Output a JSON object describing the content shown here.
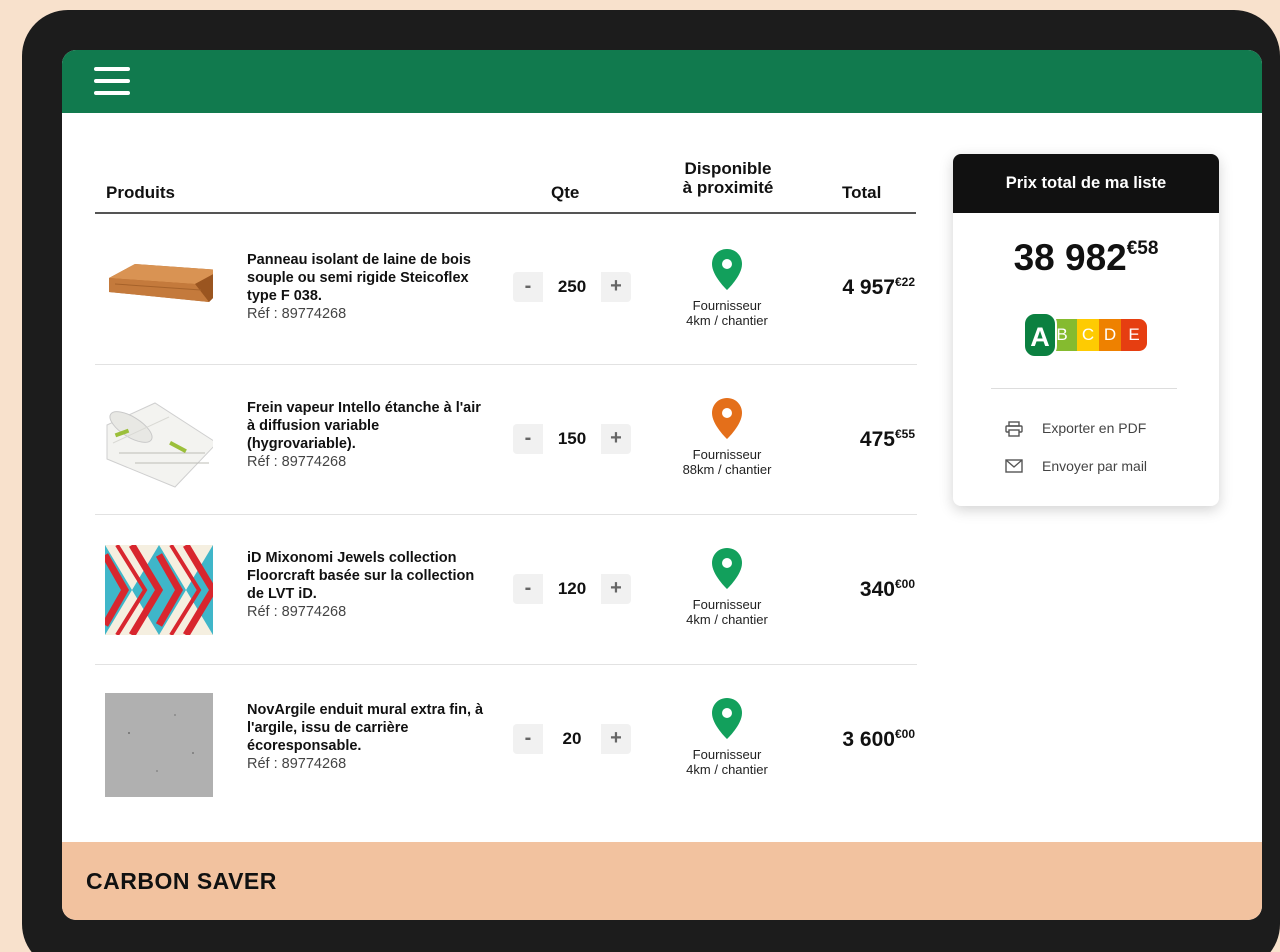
{
  "header": {
    "menu_icon": "hamburger-icon",
    "color": "#117a4e"
  },
  "columns": {
    "produits": "Produits",
    "qte": "Qte",
    "disponible_line1": "Disponible",
    "disponible_line2": "à proximité",
    "total": "Total"
  },
  "products": [
    {
      "name": "Panneau isolant de laine de bois souple ou semi rigide Steicoflex type F 038.",
      "ref": "Réf : 89774268",
      "qty": "250",
      "minus": "-",
      "plus": "+",
      "availability_icon": "map-pin-icon",
      "availability_color": "#12a05c",
      "supplier": "Fournisseur",
      "distance": "4km / chantier",
      "total_main": "4 957",
      "total_cents": "€22"
    },
    {
      "name": "Frein vapeur Intello étanche à l'air à diffusion variable (hygrovariable).",
      "ref": "Réf : 89774268",
      "qty": "150",
      "minus": "-",
      "plus": "+",
      "availability_icon": "map-pin-icon",
      "availability_color": "#e46f1a",
      "supplier": "Fournisseur",
      "distance": "88km / chantier",
      "total_main": "475",
      "total_cents": "€55"
    },
    {
      "name": "iD Mixonomi Jewels collection Floorcraft basée sur la collection de LVT iD.",
      "ref": "Réf : 89774268",
      "qty": "120",
      "minus": "-",
      "plus": "+",
      "availability_icon": "map-pin-icon",
      "availability_color": "#12a05c",
      "supplier": "Fournisseur",
      "distance": "4km / chantier",
      "total_main": "340",
      "total_cents": "€00"
    },
    {
      "name": "NovArgile enduit mural extra fin, à l'argile, issu de carrière écoresponsable.",
      "ref": "Réf : 89774268",
      "qty": "20",
      "minus": "-",
      "plus": "+",
      "availability_icon": "map-pin-icon",
      "availability_color": "#12a05c",
      "supplier": "Fournisseur",
      "distance": "4km / chantier",
      "total_main": "3 600",
      "total_cents": "€00"
    }
  ],
  "summary": {
    "title": "Prix total de ma liste",
    "total_main": "38 982",
    "total_cents": "€58",
    "score_letters": [
      "A",
      "B",
      "C",
      "D",
      "E"
    ],
    "score_selected": "A",
    "score_colors": [
      "#0b8040",
      "#85bb2f",
      "#fecb02",
      "#ee8100",
      "#e63e11"
    ],
    "export_pdf": "Exporter en PDF",
    "export_icon": "printer-icon",
    "send_mail": "Envoyer par mail",
    "mail_icon": "envelope-icon"
  },
  "footer": {
    "brand": "CARBON SAVER"
  }
}
